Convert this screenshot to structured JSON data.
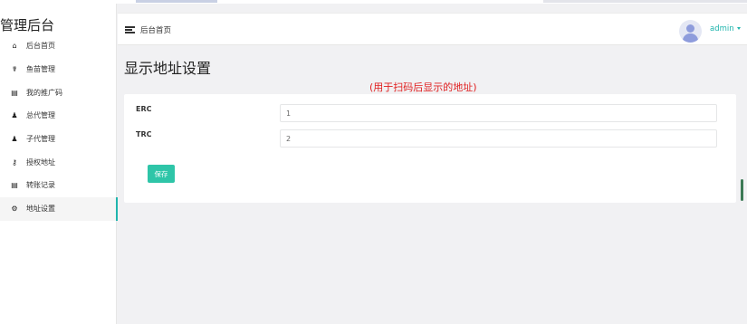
{
  "app": {
    "brand": "管理后台"
  },
  "sidebar": {
    "items": [
      {
        "icon": "home-icon",
        "glyph": "⌂",
        "label": "后台首页",
        "active": false
      },
      {
        "icon": "fish-icon",
        "glyph": "☤",
        "label": "鱼苗管理",
        "active": false
      },
      {
        "icon": "document-icon",
        "glyph": "▤",
        "label": "我的推广码",
        "active": false
      },
      {
        "icon": "user-icon",
        "glyph": "♟",
        "label": "总代管理",
        "active": false
      },
      {
        "icon": "users-icon",
        "glyph": "♟",
        "label": "子代管理",
        "active": false
      },
      {
        "icon": "key-icon",
        "glyph": "⚷",
        "label": "授权地址",
        "active": false
      },
      {
        "icon": "list-icon",
        "glyph": "▤",
        "label": "转账记录",
        "active": false
      },
      {
        "icon": "settings-icon",
        "glyph": "⚙",
        "label": "地址设置",
        "active": true
      }
    ]
  },
  "header": {
    "breadcrumb": "后台首页",
    "username": "admin"
  },
  "main": {
    "page_title": "显示地址设置",
    "notice": "(用于扫码后显示的地址)",
    "form": {
      "erc_label": "ERC",
      "erc_value": "1",
      "trc_label": "TRC",
      "trc_value": "2",
      "save_label": "保存"
    }
  },
  "colors": {
    "accent": "#1fb5ad",
    "save_button": "#2ec5a8",
    "notice": "#e02020"
  }
}
